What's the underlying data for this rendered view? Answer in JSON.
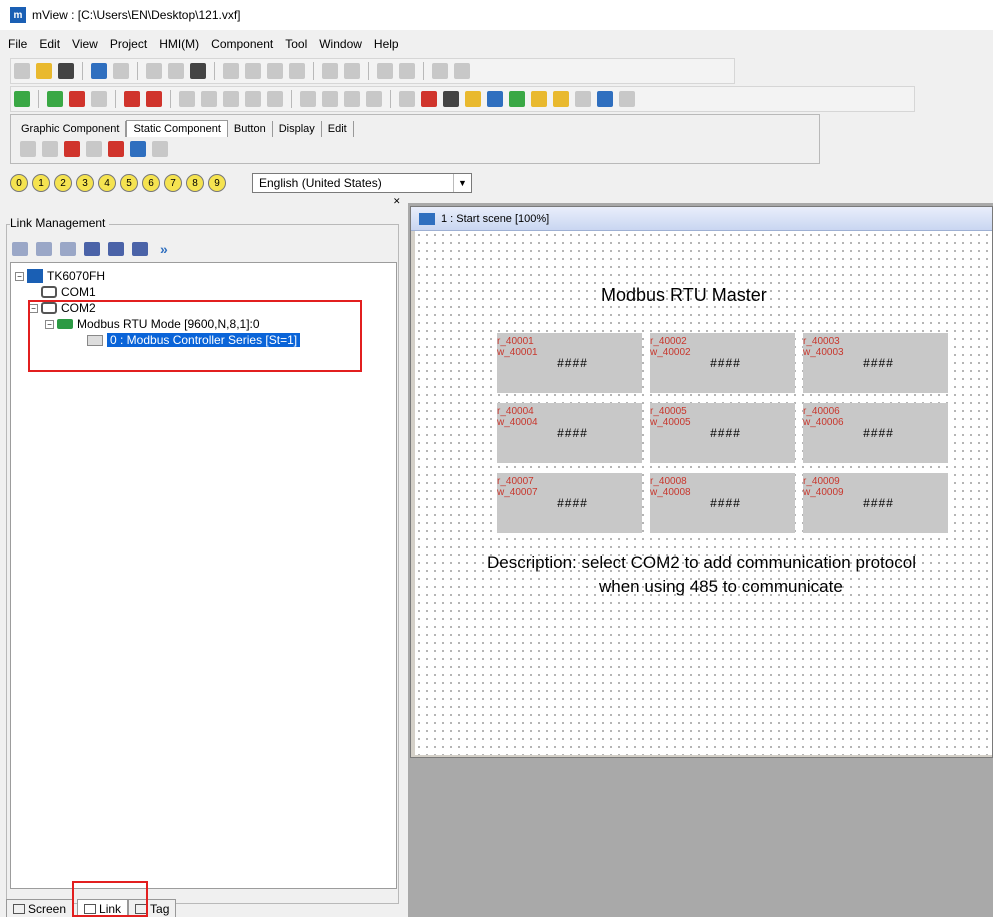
{
  "window": {
    "title": "mView : [C:\\Users\\EN\\Desktop\\121.vxf]",
    "logo": "m"
  },
  "menu": [
    "File",
    "Edit",
    "View",
    "Project",
    "HMI(M)",
    "Component",
    "Tool",
    "Window",
    "Help"
  ],
  "component_panel": {
    "tabs": [
      "Graphic Component",
      "Static Component",
      "Button",
      "Display",
      "Edit"
    ],
    "active_tab": "Static Component"
  },
  "stations": [
    "0",
    "1",
    "2",
    "3",
    "4",
    "5",
    "6",
    "7",
    "8",
    "9"
  ],
  "language": {
    "selected": "English (United States)"
  },
  "link_management": {
    "title": "Link Management",
    "tree": {
      "root": "TK6070FH",
      "com1": "COM1",
      "com2": "COM2",
      "protocol": "Modbus RTU Mode [9600,N,8,1]:0",
      "device": "0 : Modbus Controller Series [St=1]"
    }
  },
  "bottom_tabs": [
    "Screen",
    "Link",
    "Tag"
  ],
  "scene": {
    "title": "1 : Start scene [100%]",
    "heading": "Modbus RTU Master",
    "registers": [
      {
        "r": "r_40001",
        "w": "w_40001",
        "value": "####"
      },
      {
        "r": "r_40002",
        "w": "w_40002",
        "value": "####"
      },
      {
        "r": "r_40003",
        "w": "w_40003",
        "value": "####"
      },
      {
        "r": "r_40004",
        "w": "w_40004",
        "value": "####"
      },
      {
        "r": "r_40005",
        "w": "w_40005",
        "value": "####"
      },
      {
        "r": "r_40006",
        "w": "w_40006",
        "value": "####"
      },
      {
        "r": "r_40007",
        "w": "w_40007",
        "value": "####"
      },
      {
        "r": "r_40008",
        "w": "w_40008",
        "value": "####"
      },
      {
        "r": "r_40009",
        "w": "w_40009",
        "value": "####"
      }
    ],
    "description_line1": "Description: select COM2 to add communication protocol",
    "description_line2": "when using 485 to communicate"
  },
  "colors": {
    "highlight_box": "#e21f1f",
    "selection": "#0a64d8",
    "register_text": "#c8372d"
  }
}
